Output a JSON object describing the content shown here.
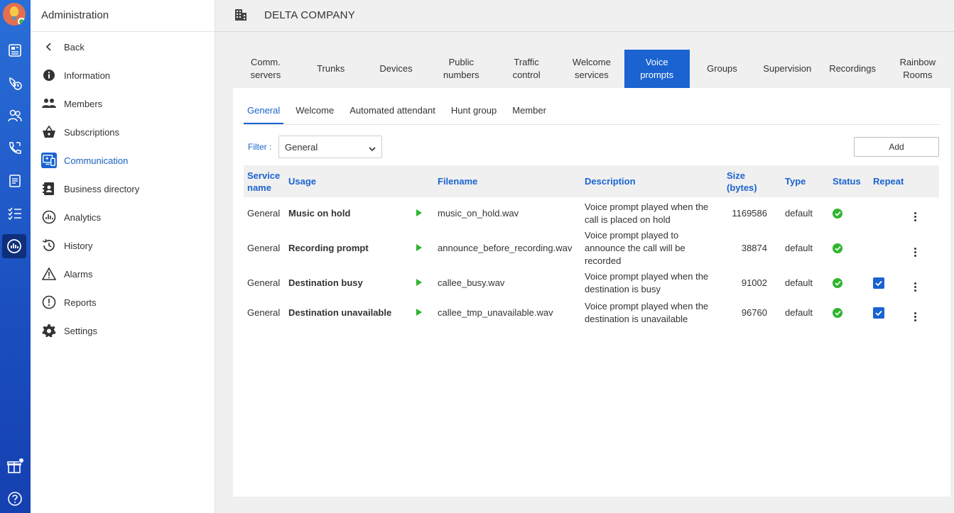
{
  "sidebar": {
    "title": "Administration",
    "items": [
      {
        "label": "Back",
        "icon": "chevron-left-icon"
      },
      {
        "label": "Information",
        "icon": "info-icon"
      },
      {
        "label": "Members",
        "icon": "people-icon"
      },
      {
        "label": "Subscriptions",
        "icon": "basket-icon"
      },
      {
        "label": "Communication",
        "icon": "communication-icon",
        "active": true
      },
      {
        "label": "Business directory",
        "icon": "directory-icon"
      },
      {
        "label": "Analytics",
        "icon": "analytics-icon"
      },
      {
        "label": "History",
        "icon": "history-icon"
      },
      {
        "label": "Alarms",
        "icon": "alarm-icon"
      },
      {
        "label": "Reports",
        "icon": "report-icon"
      },
      {
        "label": "Settings",
        "icon": "gear-icon"
      }
    ]
  },
  "header": {
    "company": "DELTA COMPANY",
    "icon": "building-icon"
  },
  "tabs": [
    {
      "label": "Comm. servers"
    },
    {
      "label": "Trunks"
    },
    {
      "label": "Devices"
    },
    {
      "label": "Public numbers"
    },
    {
      "label": "Traffic control"
    },
    {
      "label": "Welcome services"
    },
    {
      "label": "Voice prompts",
      "active": true
    },
    {
      "label": "Groups"
    },
    {
      "label": "Supervision"
    },
    {
      "label": "Recordings"
    },
    {
      "label": "Rainbow Rooms"
    }
  ],
  "subtabs": [
    {
      "label": "General",
      "active": true
    },
    {
      "label": "Welcome"
    },
    {
      "label": "Automated attendant"
    },
    {
      "label": "Hunt group"
    },
    {
      "label": "Member"
    }
  ],
  "filter": {
    "label": "Filter :",
    "value": "General"
  },
  "add_label": "Add",
  "table": {
    "headers": {
      "service": "Service name",
      "usage": "Usage",
      "filename": "Filename",
      "description": "Description",
      "size": "Size (bytes)",
      "type": "Type",
      "status": "Status",
      "repeat": "Repeat"
    },
    "rows": [
      {
        "service": "General",
        "usage": "Music on hold",
        "filename": "music_on_hold.wav",
        "description": "Voice prompt played when the call is placed on hold",
        "size": "1169586",
        "type": "default",
        "status": "ok",
        "repeat": false
      },
      {
        "service": "General",
        "usage": "Recording prompt",
        "filename": "announce_before_recording.wav",
        "description": "Voice prompt played to announce the call will be recorded",
        "size": "38874",
        "type": "default",
        "status": "ok",
        "repeat": false
      },
      {
        "service": "General",
        "usage": "Destination busy",
        "filename": "callee_busy.wav",
        "description": "Voice prompt played when the destination is busy",
        "size": "91002",
        "type": "default",
        "status": "ok",
        "repeat": true
      },
      {
        "service": "General",
        "usage": "Destination unavailable",
        "filename": "callee_tmp_unavailable.wav",
        "description": "Voice prompt played when the destination is unavailable",
        "size": "96760",
        "type": "default",
        "status": "ok",
        "repeat": true
      }
    ]
  },
  "colors": {
    "accent": "#1a63d0",
    "rail": "#1b4fc0",
    "success": "#2db52d"
  }
}
